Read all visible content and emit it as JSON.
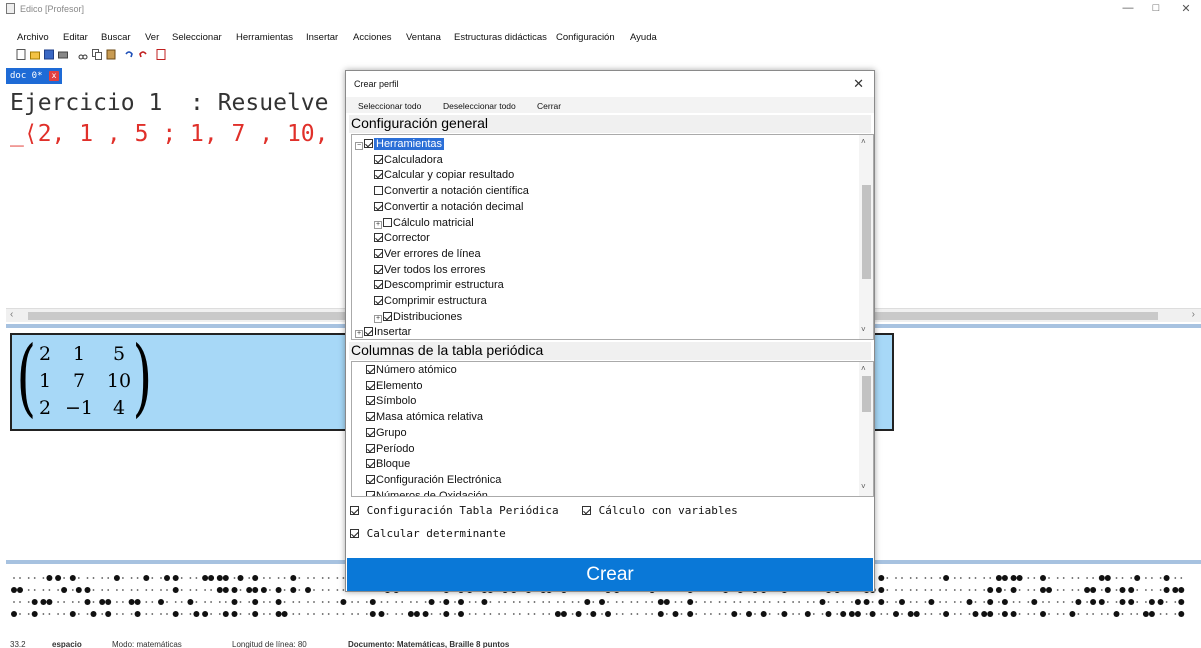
{
  "window": {
    "title": "Edico [Profesor]"
  },
  "menu": [
    "Archivo",
    "Editar",
    "Buscar",
    "Ver",
    "Seleccionar",
    "Herramientas",
    "Insertar",
    "Acciones",
    "Ventana",
    "Estructuras didácticas",
    "Configuración",
    "Ayuda"
  ],
  "doc_tab": {
    "label": "doc 0*",
    "close_label": "x"
  },
  "editor": {
    "line1": "Ejercicio 1  : Resuelve",
    "line2": "_⟨2, 1 , 5 ; 1, 7 , 10,"
  },
  "matrix": {
    "rows": [
      [
        "2",
        "1",
        "5"
      ],
      [
        "1",
        "7",
        "10"
      ],
      [
        "2",
        "−1",
        "4"
      ]
    ]
  },
  "dialog": {
    "title": "Crear perfil",
    "close": "✕",
    "toolbar": [
      "Seleccionar todo",
      "Deseleccionar todo",
      "Cerrar"
    ],
    "section1": "Configuración general",
    "tree1": [
      {
        "label": "Herramientas",
        "checked": true,
        "level": 0,
        "expander": "−",
        "selected": true
      },
      {
        "label": "Calculadora",
        "checked": true,
        "level": 1
      },
      {
        "label": "Calcular y copiar resultado",
        "checked": true,
        "level": 1
      },
      {
        "label": "Convertir a notación científica",
        "checked": false,
        "level": 1
      },
      {
        "label": "Convertir a notación decimal",
        "checked": true,
        "level": 1
      },
      {
        "label": "Cálculo matricial",
        "checked": false,
        "level": 1,
        "expander": "+"
      },
      {
        "label": "Corrector",
        "checked": true,
        "level": 1
      },
      {
        "label": "Ver errores de línea",
        "checked": true,
        "level": 1
      },
      {
        "label": "Ver todos los errores",
        "checked": true,
        "level": 1
      },
      {
        "label": "Descomprimir estructura",
        "checked": true,
        "level": 1
      },
      {
        "label": "Comprimir estructura",
        "checked": true,
        "level": 1
      },
      {
        "label": "Distribuciones",
        "checked": true,
        "level": 1,
        "expander": "+"
      },
      {
        "label": "Insertar",
        "checked": true,
        "level": 0,
        "expander": "+"
      }
    ],
    "section2": "Columnas de la tabla periódica",
    "tree2": [
      {
        "label": "Número atómico",
        "checked": true
      },
      {
        "label": "Elemento",
        "checked": true
      },
      {
        "label": "Símbolo",
        "checked": true
      },
      {
        "label": "Masa atómica relativa",
        "checked": true
      },
      {
        "label": "Grupo",
        "checked": true
      },
      {
        "label": "Período",
        "checked": true
      },
      {
        "label": "Bloque",
        "checked": true
      },
      {
        "label": "Configuración Electrónica",
        "checked": true
      },
      {
        "label": "Números de Oxidación",
        "checked": true
      }
    ],
    "options": [
      {
        "label": "Configuración Tabla Periódica",
        "checked": true
      },
      {
        "label": "Cálculo con variables",
        "checked": true
      },
      {
        "label": "Calcular determinante",
        "checked": true
      }
    ],
    "create_button": "Crear"
  },
  "statusbar": {
    "position": "33.2",
    "char": "espacio",
    "mode": "Modo: matemáticas",
    "line_length": "Longitud de línea: 80",
    "document": "Documento: Matemáticas, Braille 8 puntos"
  },
  "colors": {
    "accent": "#0a78d7",
    "matrix_panel": "#a7d8f7",
    "editor_red": "#e0302a",
    "tab_blue": "#1e6bd6"
  }
}
